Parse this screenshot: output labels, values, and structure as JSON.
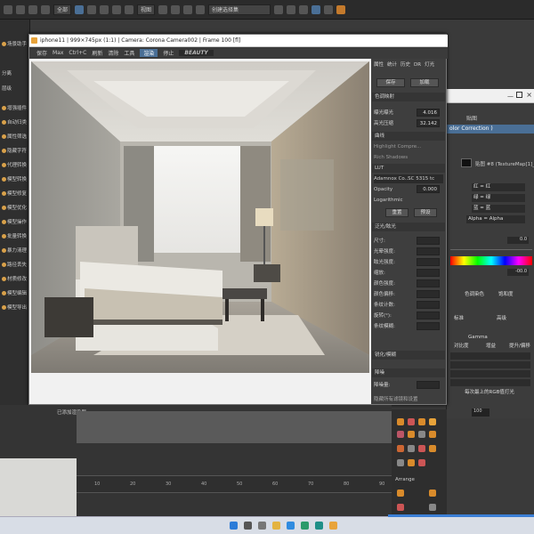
{
  "render_window": {
    "title": "iphone11 | 999×745px (1:1) | Camera: Corona Camera002 | Frame 100 [fl]",
    "toolbar": {
      "save": "保存",
      "max": "Max",
      "ctrl_c": "Ctrl+C",
      "refresh": "刷新",
      "clear": "清除",
      "tools": "工具",
      "render_btn": "渲染",
      "stop": "停止",
      "channel": "BEAUTY"
    }
  },
  "top_toolbar": {
    "dropdown_1": "全部",
    "dropdown_2": "视图",
    "selection_set": "创建选择集"
  },
  "left_panel": {
    "items": [
      "场景助手",
      "分离",
      "层级",
      "增强插件",
      "自动归类",
      "属性筛选",
      "隐藏字符",
      "代理转换",
      "模型转换",
      "模型修复",
      "模型优化",
      "模型操作",
      "批量转换",
      "暴力清理",
      "路径丢失",
      "材质修改",
      "模型编辑",
      "模型导出"
    ]
  },
  "settings_panel": {
    "tabs": [
      "属性",
      "统计",
      "历史",
      "DR",
      "灯光"
    ],
    "save": "保存",
    "load": "加载",
    "tone_mapping": "色调映射",
    "exposure_label": "曝光曝光",
    "exposure_value": "4.016",
    "highlight_label": "高光压缩",
    "highlight_value": "32.142",
    "section_curve": "曲线",
    "highlight_compression": "Highlight Compre...",
    "rich_shadows": "Rich Shadows",
    "lut": "LUT",
    "lut_name": "Adamnox Co..SC 5315 tc",
    "opacity": "Opacity",
    "opacity_value": "0.000",
    "logarithmic": "Logarithmic",
    "reset": "重置",
    "preview": "预设",
    "section_bloom": "泛光/眩光",
    "size": "尺寸:",
    "bloom_strength": "光晕强度:",
    "glare_strength": "眩光强度:",
    "scale": "缩放:",
    "color_intensity": "颜色强度:",
    "color_shift": "颜色偏移:",
    "streak_count": "条纹计数:",
    "rotation": "旋转(°):",
    "streak_blur": "条纹模糊:",
    "section_sharpen": "锐化/模糊",
    "section_denoise": "降噪",
    "denoise_amount": "降噪量:",
    "footer": "隐藏所有滤镜和设置"
  },
  "color_correction": {
    "tab": "贴图",
    "title": "olor Correction )",
    "map_label": "贴图 #8 (TextureMap[1]_Cory",
    "red": "红 = 红",
    "green": "绿 = 绿",
    "blue": "蓝 = 蓝",
    "alpha": "Alpha = Alpha",
    "value_1": "0.0",
    "value_2": "-00.0",
    "color_label": "色调染色",
    "saturation": "饱和度",
    "standard": "标准",
    "advanced": "高级",
    "gamma": "Gamma",
    "contrast": "对比度",
    "gain": "增益",
    "offset": "提升/偏移",
    "footer": "每次最上的RGB值打光"
  },
  "timeline": {
    "label": "已添加渲染器",
    "ticks": [
      "0",
      "5",
      "10",
      "15",
      "20",
      "25",
      "30",
      "35",
      "40",
      "45",
      "50",
      "55",
      "60",
      "65",
      "70",
      "75",
      "80",
      "85",
      "90",
      "95",
      "100"
    ],
    "frame_field": "100",
    "arrange_label": "Arrange"
  },
  "colors": {
    "accent": "#4a6f96",
    "progress": "#3c7fd6",
    "panel": "#3e3e3e",
    "orange": "#e8a33a"
  }
}
